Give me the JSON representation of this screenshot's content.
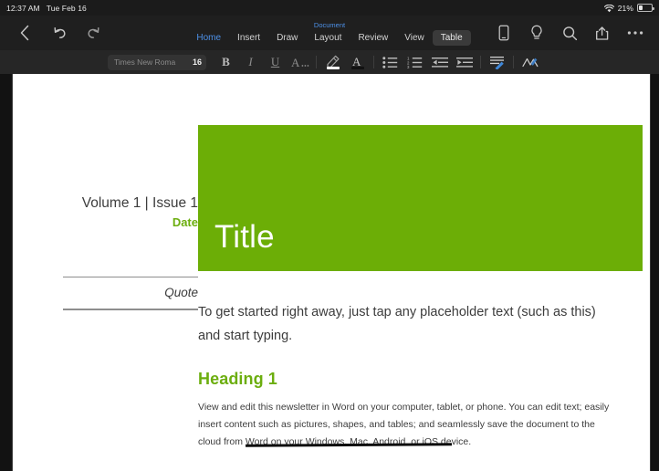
{
  "status_bar": {
    "time": "12:37 AM",
    "date": "Tue Feb 16",
    "wifi_icon": "wifi-icon",
    "battery_percent": "21%",
    "battery_icon": "battery-icon"
  },
  "navbar": {
    "back_icon": "back-chevron-icon",
    "undo_icon": "undo-icon",
    "redo_icon": "redo-icon",
    "document_label": "Document",
    "tabs": [
      {
        "label": "Home",
        "state": "active"
      },
      {
        "label": "Insert",
        "state": "normal"
      },
      {
        "label": "Draw",
        "state": "normal"
      },
      {
        "label": "Layout",
        "state": "normal"
      },
      {
        "label": "Review",
        "state": "normal"
      },
      {
        "label": "View",
        "state": "normal"
      },
      {
        "label": "Table",
        "state": "pressed"
      }
    ],
    "right_icons": [
      {
        "name": "mobile-view-icon"
      },
      {
        "name": "lightbulb-icon"
      },
      {
        "name": "search-icon"
      },
      {
        "name": "share-icon"
      },
      {
        "name": "more-ellipsis-icon"
      }
    ]
  },
  "format_bar": {
    "font_name": "Times New Roma",
    "font_size": "16",
    "bold_label": "B",
    "italic_label": "I",
    "underline_label": "U",
    "font_effects_label": "A",
    "font_color_label": "A",
    "highlight_color": "#ffffff",
    "font_color": "#000000",
    "buttons": [
      {
        "name": "bold-button"
      },
      {
        "name": "italic-button"
      },
      {
        "name": "underline-button"
      },
      {
        "name": "font-effects-button"
      },
      {
        "name": "highlight-color-button"
      },
      {
        "name": "font-color-button"
      },
      {
        "name": "bullet-list-button"
      },
      {
        "name": "numbered-list-button"
      },
      {
        "name": "decrease-indent-button"
      },
      {
        "name": "increase-indent-button"
      },
      {
        "name": "paragraph-format-button"
      },
      {
        "name": "styles-button"
      }
    ]
  },
  "document": {
    "volume": "Volume 1 | Issue 1",
    "date": "Date",
    "quote": "Quote",
    "banner_title": "Title",
    "banner_color": "#6cae06",
    "heading_accent_color": "#6cae0f",
    "intro": "To get started right away, just tap any placeholder text (such as this) and start typing.",
    "heading1": "Heading 1",
    "paragraph": "View and edit this newsletter in Word on your computer, tablet, or phone. You can edit text; easily insert content such as pictures, shapes, and tables; and seamlessly save the document to the cloud from Word on your Windows, Mac, Android, or iOS device."
  }
}
